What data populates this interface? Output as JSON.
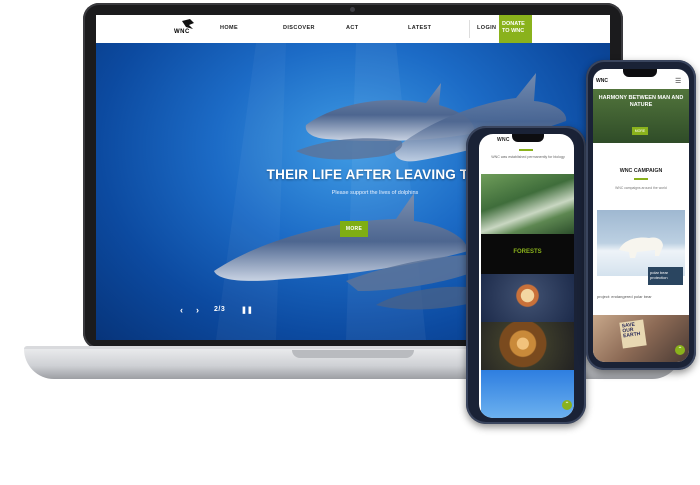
{
  "brand": {
    "logo_text": "WNC"
  },
  "colors": {
    "accent": "#8ab21c",
    "hero_blue": "#1c6bc6"
  },
  "nav": {
    "home": "HOME",
    "discover": "DISCOVER",
    "act": "ACT",
    "latest": "LATEST",
    "login": "LOGIN",
    "donate_line1": "DONATE",
    "donate_line2": "TO WNC"
  },
  "hero": {
    "title": "THEIR LIFE AFTER LEAVING THE ZOO",
    "subtitle": "Please support the lives of dolphins",
    "button": "MORE",
    "pager": "2/3",
    "prev_icon": "chevron-left-icon",
    "next_icon": "chevron-right-icon",
    "pause_icon": "pause-icon"
  },
  "phone1": {
    "heading": "WNC",
    "intro": "WNC was established permanently for biology",
    "band_label": "FORESTS"
  },
  "phone2": {
    "logo": "WNC",
    "hero_title": "HARMONY BETWEEN MAN AND NATURE",
    "hero_button": "MORE",
    "campaign_title": "WNC CAMPAIGN",
    "campaign_text": "WNC campaigns around the world",
    "card_button": "polar bear protection",
    "card_caption": "project: endangered polar bear",
    "sign_text": "SAVE OUR EARTH"
  }
}
